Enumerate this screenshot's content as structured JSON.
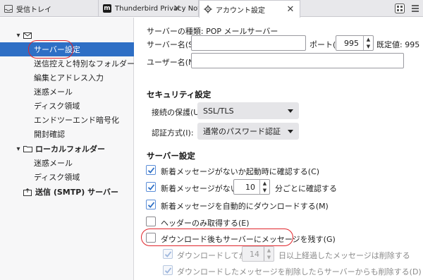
{
  "tabs": [
    {
      "label": "受信トレイ"
    },
    {
      "label": "Thunderbird Privacy Notice"
    },
    {
      "label": "アカウント設定"
    }
  ],
  "sidebar": {
    "account_items": [
      {
        "label": "サーバー設定"
      },
      {
        "label": "送信控えと特別なフォルダー"
      },
      {
        "label": "編集とアドレス入力"
      },
      {
        "label": "迷惑メール"
      },
      {
        "label": "ディスク領域"
      },
      {
        "label": "エンドツーエンド暗号化"
      },
      {
        "label": "開封確認"
      }
    ],
    "local_folders": {
      "label": "ローカルフォルダー"
    },
    "local_items": [
      {
        "label": "迷惑メール"
      },
      {
        "label": "ディスク領域"
      }
    ],
    "smtp": {
      "label": "送信 (SMTP) サーバー"
    }
  },
  "server": {
    "type_line": "サーバーの種類: POP メールサーバー",
    "name_label": "サーバー名(S):",
    "name_value": "",
    "port_label": "ポート(P):",
    "port_value": "995",
    "default_label": "既定値: 995",
    "user_label": "ユーザー名(N):",
    "user_value": ""
  },
  "security": {
    "heading": "セキュリティ設定",
    "conn_label": "接続の保護(U):",
    "conn_value": "SSL/TLS",
    "auth_label": "認証方式(I):",
    "auth_value": "通常のパスワード認証"
  },
  "server_settings": {
    "heading": "サーバー設定",
    "opt_startup": {
      "label": "新着メッセージがないか起動時に確認する(C)",
      "checked": true
    },
    "opt_interval": {
      "label_pre": "新着メッセージがないか(Y)",
      "minutes": "10",
      "label_post": "分ごとに確認する",
      "checked": true
    },
    "opt_auto_dl": {
      "label": "新着メッセージを自動的にダウンロードする(M)",
      "checked": true
    },
    "opt_headers": {
      "label": "ヘッダーのみ取得する(E)",
      "checked": false
    },
    "opt_leave": {
      "label": "ダウンロード後もサーバーにメッセージを残す(G)",
      "checked": false
    },
    "opt_days": {
      "label_pre": "ダウンロードしてから(O)",
      "days": "14",
      "label_post": "日以上経過したメッセージは削除する",
      "checked": true,
      "disabled": true
    },
    "opt_delete": {
      "label": "ダウンロードしたメッセージを削除したらサーバーからも削除する(D)",
      "checked": true,
      "disabled": true
    }
  },
  "colors": {
    "accent": "#2e6fc5",
    "highlight_oval": "#e0252b"
  }
}
